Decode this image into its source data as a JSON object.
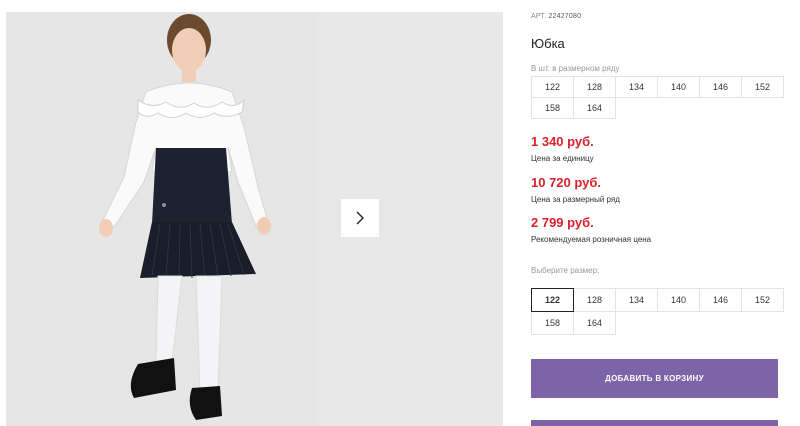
{
  "gallery": {
    "next_icon": "chevron-right-icon"
  },
  "product": {
    "art_label": "АРТ.",
    "art_number": "22427080",
    "title": "Юбка"
  },
  "pack_sizes": {
    "hint": "В шт. в размерном ряду",
    "sizes": [
      "122",
      "128",
      "134",
      "140",
      "146",
      "152",
      "158",
      "164"
    ]
  },
  "prices": [
    {
      "value": "1 340 руб.",
      "label": "Цена за единицу"
    },
    {
      "value": "10 720 руб.",
      "label": "Цена за размерный ряд"
    },
    {
      "value": "2 799 руб.",
      "label": "Рекомендуемая розничная цена"
    }
  ],
  "size_select": {
    "hint": "Выберите размер:",
    "sizes": [
      "122",
      "128",
      "134",
      "140",
      "146",
      "152",
      "158",
      "164"
    ],
    "selected": "122"
  },
  "actions": {
    "add_to_cart": "ДОБАВИТЬ В КОРЗИНУ"
  },
  "colors": {
    "price": "#d9222a",
    "button": "#7d63a8"
  }
}
